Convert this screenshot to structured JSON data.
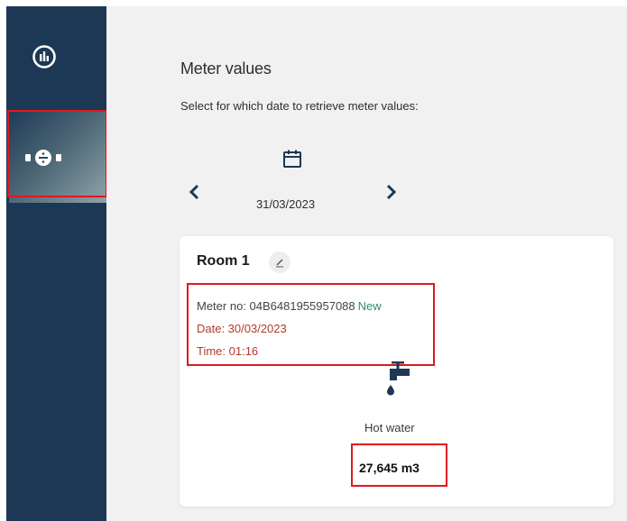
{
  "colors": {
    "sidebar": "#1d3854",
    "main_bg": "#f1f1f1",
    "highlight_red": "#e0181e",
    "date_red": "#b33a2c",
    "new_green": "#2f8b6e"
  },
  "sidebar": {
    "items": [
      {
        "icon": "chart-circle-icon",
        "active": false
      },
      {
        "icon": "water-meter-icon",
        "active": true
      }
    ]
  },
  "header": {
    "title": "Meter values",
    "subtitle": "Select for which date to retrieve meter values:"
  },
  "date_picker": {
    "icon": "calendar-icon",
    "value": "31/03/2023",
    "prev_icon": "chevron-left-icon",
    "next_icon": "chevron-right-icon"
  },
  "room_card": {
    "title": "Room 1",
    "edit_icon": "pencil-icon",
    "meter_no_label": "Meter no: 04B6481955957088",
    "new_badge": "New",
    "date_text": "Date: 30/03/2023",
    "time_text": "Time: 01:16",
    "meter_icon": "tap-icon",
    "meter_type": "Hot water",
    "reading": "27,645 m3"
  }
}
